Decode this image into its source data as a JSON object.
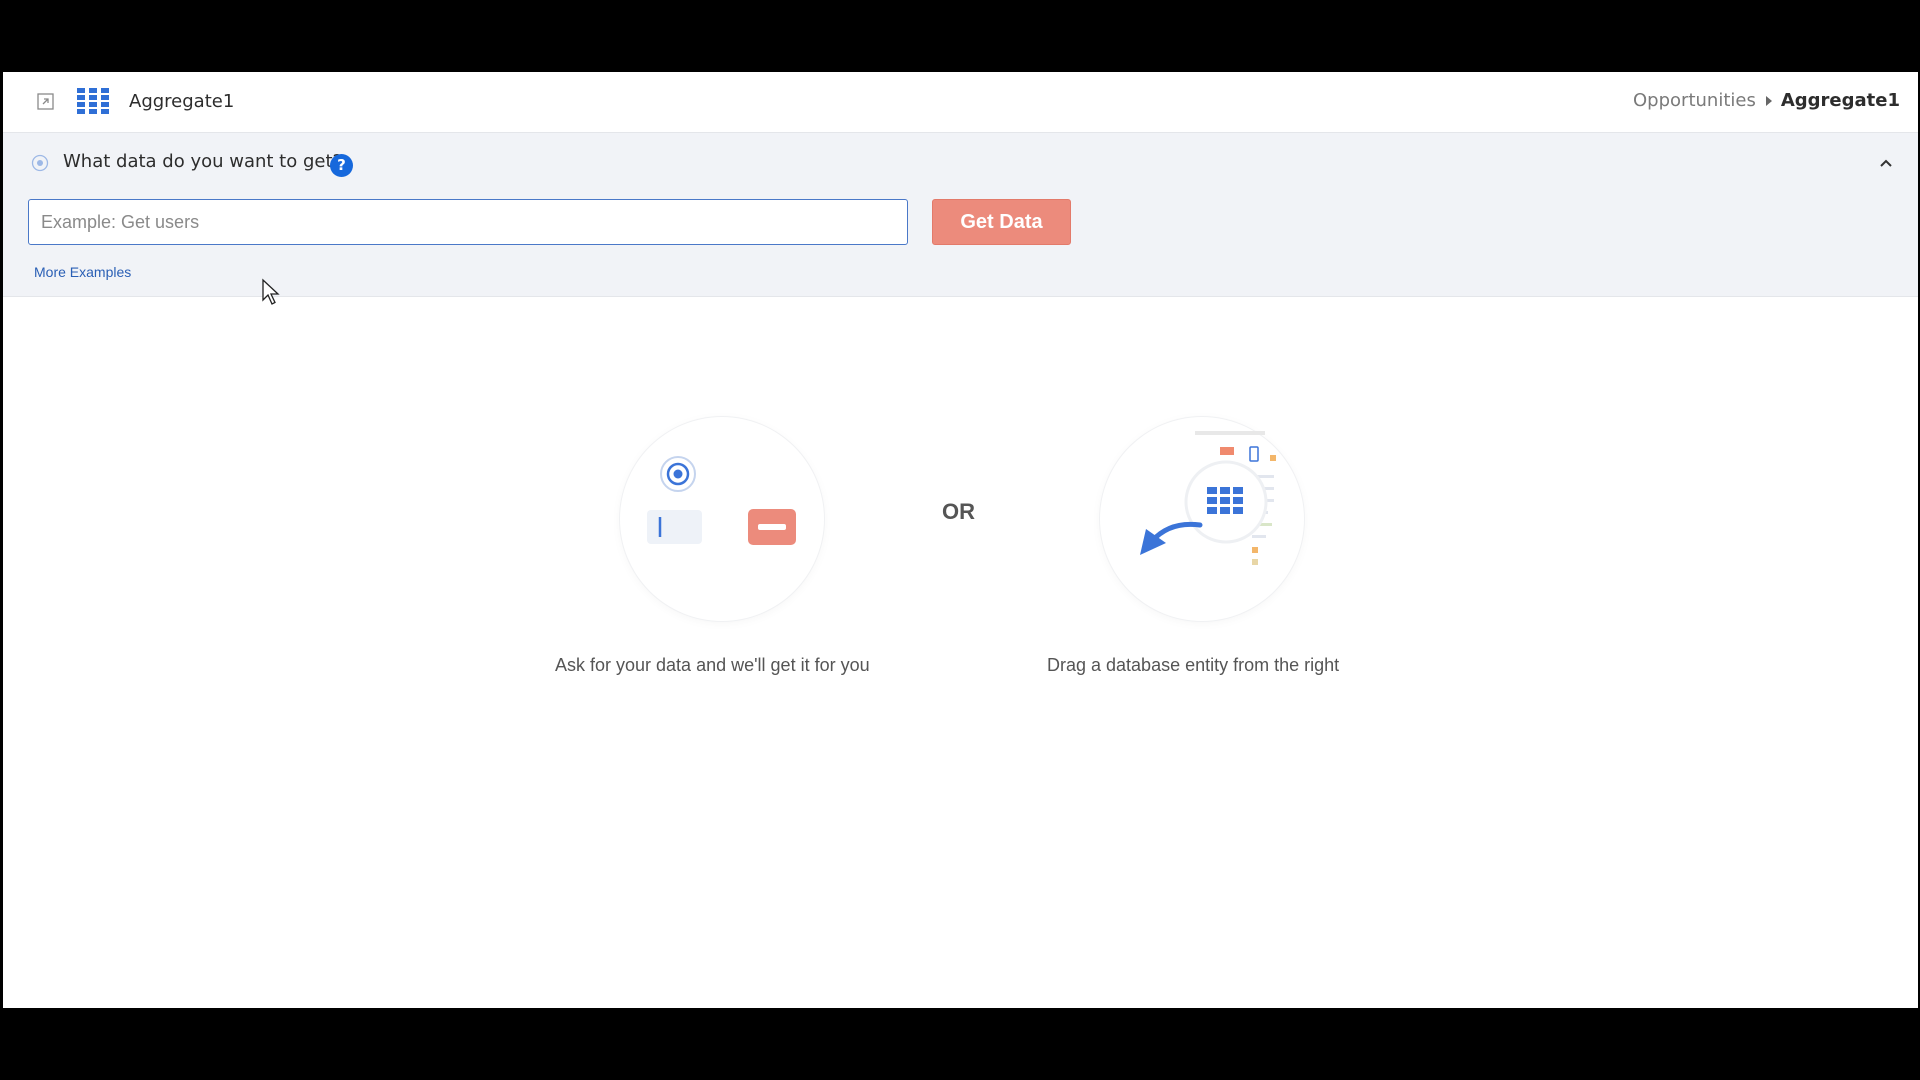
{
  "header": {
    "title": "Aggregate1",
    "breadcrumb": {
      "parent": "Opportunities",
      "current": "Aggregate1"
    }
  },
  "query": {
    "label": "What data do you want to get?",
    "help_glyph": "?",
    "input_placeholder": "Example: Get users",
    "input_value": "",
    "button_label": "Get Data",
    "more_examples": "More Examples"
  },
  "main": {
    "or_text": "OR",
    "left_caption": "Ask for your data and we'll get it for you",
    "right_caption": "Drag a database entity from the right"
  },
  "colors": {
    "accent_blue": "#1668dc",
    "button_salmon": "#ec8b7c",
    "panel_bg": "#f1f3f7"
  },
  "icons": {
    "expand": "expand-icon",
    "grid": "grid-icon",
    "query": "target-icon",
    "help": "help-icon",
    "collapse": "chevron-up-icon"
  }
}
